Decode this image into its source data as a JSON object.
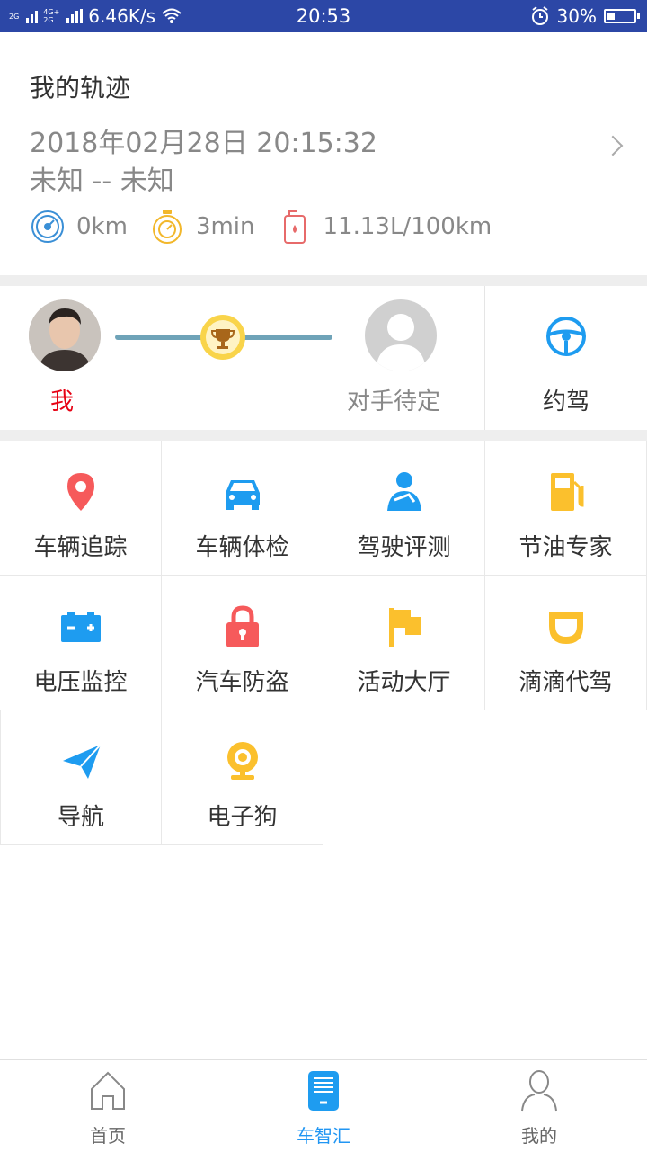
{
  "status_bar": {
    "network_top": "2G",
    "network_bottom": "2G",
    "network2_top": "4G+",
    "network2_bottom": "2G",
    "speed": "6.46K/s",
    "time": "20:53",
    "battery_percent": "30%",
    "battery_level": 0.3
  },
  "track": {
    "title": "我的轨迹",
    "datetime": "2018年02月28日 20:15:32",
    "route": "未知 -- 未知",
    "distance": "0km",
    "duration": "3min",
    "fuel": "11.13L/100km"
  },
  "competition": {
    "me_label": "我",
    "opponent_label": "对手待定",
    "yuejia_label": "约驾"
  },
  "features": [
    {
      "label": "车辆追踪",
      "icon": "location-pin-icon"
    },
    {
      "label": "车辆体检",
      "icon": "car-icon"
    },
    {
      "label": "驾驶评测",
      "icon": "driver-icon"
    },
    {
      "label": "节油专家",
      "icon": "fuel-pump-icon"
    },
    {
      "label": "电压监控",
      "icon": "battery-icon"
    },
    {
      "label": "汽车防盗",
      "icon": "lock-icon"
    },
    {
      "label": "活动大厅",
      "icon": "flag-icon"
    },
    {
      "label": "滴滴代驾",
      "icon": "didi-icon"
    },
    {
      "label": "导航",
      "icon": "paper-plane-icon"
    },
    {
      "label": "电子狗",
      "icon": "camera-icon"
    }
  ],
  "tabbar": {
    "home": "首页",
    "hub": "车智汇",
    "mine": "我的"
  },
  "colors": {
    "status_bar": "#2c47a6",
    "accent_blue": "#2196f3",
    "red": "#f65a5b",
    "yellow": "#fbc02d",
    "me_red": "#e60012"
  }
}
